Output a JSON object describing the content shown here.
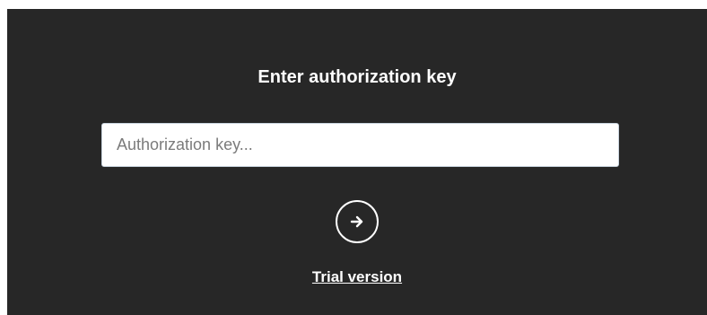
{
  "dialog": {
    "title": "Enter authorization key",
    "key_input": {
      "placeholder": "Authorization key...",
      "value": ""
    },
    "submit_button": {
      "icon": "arrow-right-icon"
    },
    "trial_link_label": "Trial version"
  },
  "colors": {
    "background": "#272727",
    "text": "#ffffff",
    "input_background": "#ffffff",
    "input_border": "#c9d4de",
    "placeholder": "#7b7b7b"
  }
}
